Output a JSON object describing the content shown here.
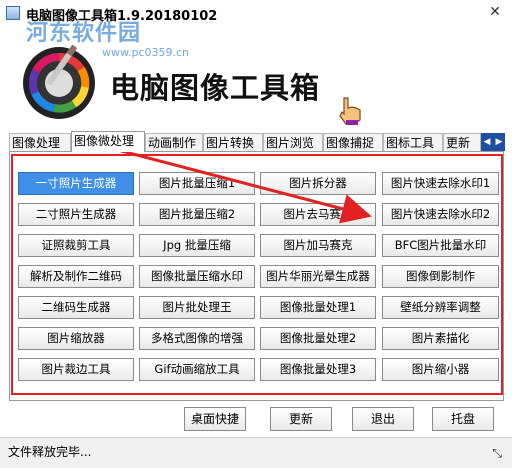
{
  "window": {
    "title": "电脑图像工具箱1.9.20180102",
    "close": "✕"
  },
  "watermark": {
    "text": "河东软件园",
    "url": "www.pc0359.cn"
  },
  "header": {
    "app_title": "电脑图像工具箱"
  },
  "tabs": [
    {
      "label": "图像处理"
    },
    {
      "label": "图像微处理"
    },
    {
      "label": "动画制作"
    },
    {
      "label": "图片转换"
    },
    {
      "label": "图片浏览"
    },
    {
      "label": "图像捕捉"
    },
    {
      "label": "图标工具"
    },
    {
      "label": "更新"
    }
  ],
  "active_tab": "图像微处理",
  "tab_scroll": {
    "left": "◀",
    "right": "▶"
  },
  "tools": [
    [
      "一寸照片生成器",
      "图片批量压缩1",
      "图片拆分器",
      "图片快速去除水印1"
    ],
    [
      "二寸照片生成器",
      "图片批量压缩2",
      "图片去马赛克",
      "图片快速去除水印2"
    ],
    [
      "证照裁剪工具",
      "Jpg 批量压缩",
      "图片加马赛克",
      "BFC图片批量水印"
    ],
    [
      "解析及制作二维码",
      "图像批量压缩水印",
      "图片华丽光晕生成器",
      "图像倒影制作"
    ],
    [
      "二维码生成器",
      "图片批处理王",
      "图像批量处理1",
      "壁纸分辨率调整"
    ],
    [
      "图片缩放器",
      "多格式图像的增强",
      "图像批量处理2",
      "图片素描化"
    ],
    [
      "图片裁边工具",
      "Gif动画缩放工具",
      "图像批量处理3",
      "图片缩小器"
    ]
  ],
  "selected_tool": "一寸照片生成器",
  "bottom_buttons": {
    "desktop_shortcut": "桌面快捷",
    "update": "更新",
    "exit": "退出",
    "tray": "托盘"
  },
  "status": {
    "text": "文件释放完毕..."
  },
  "colors": {
    "highlight_red": "#e22222",
    "selected_blue": "#3f8fe6",
    "tab_arrow_blue": "#1f4fa0"
  }
}
